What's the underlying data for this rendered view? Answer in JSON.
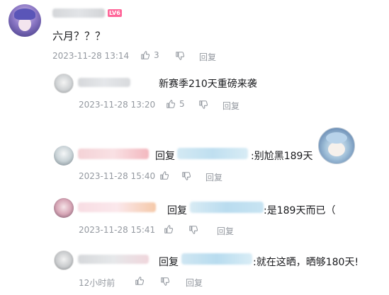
{
  "main_comment": {
    "level_badge": "LV6",
    "text": "六月？？？",
    "date": "2023-11-28 13:14",
    "likes": "3",
    "reply_label": "回复"
  },
  "replies": [
    {
      "text": "新赛季210天重磅来袭",
      "date": "2023-11-28 13:20",
      "likes": "5",
      "reply_label": "回复"
    },
    {
      "prefix": "回复",
      "text": ":别尬黑189天",
      "date": "2023-11-28 15:40",
      "reply_label": "回复"
    },
    {
      "prefix": "回复",
      "text": ":是189天而已（",
      "date": "2023-11-28 15:41",
      "reply_label": "回复"
    },
    {
      "prefix": "回复",
      "text": ":就在这晒，晒够180天!",
      "date": "12小时前",
      "reply_label": "回复"
    }
  ],
  "colors": {
    "meta_gray": "#9499a0",
    "text": "#18191c",
    "level_pink": "#ff6699"
  }
}
